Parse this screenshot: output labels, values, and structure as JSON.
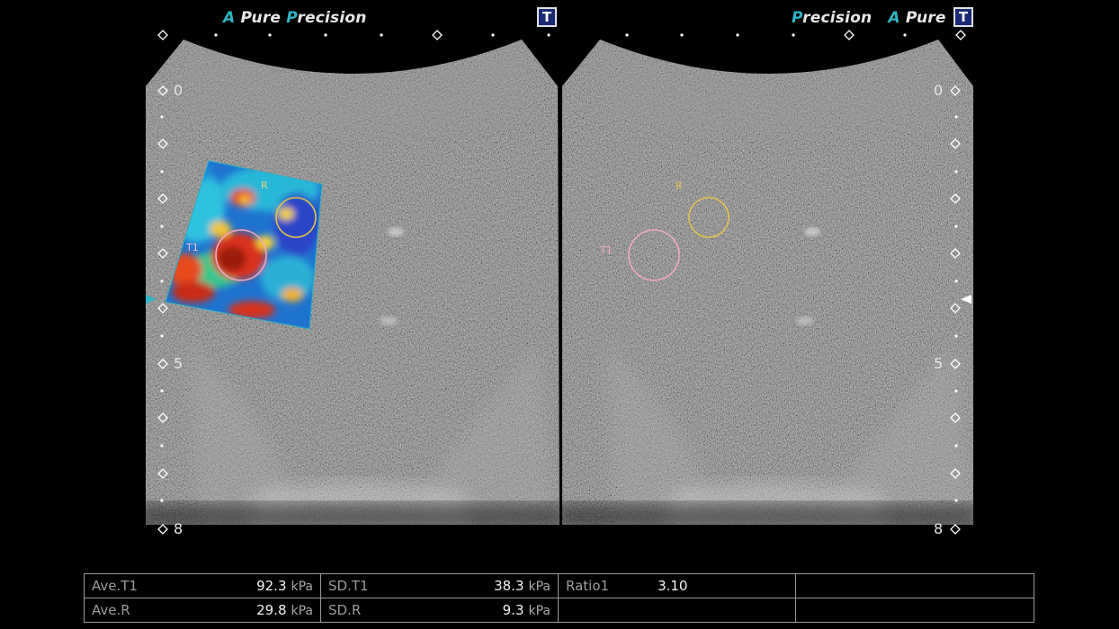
{
  "header": {
    "left": {
      "a": "A",
      "pure": "Pure",
      "p": "P",
      "recision": "recision"
    },
    "right": {
      "p": "P",
      "recision": "recision",
      "a": "A",
      "pure": "Pure"
    },
    "badge": "T"
  },
  "depth_scale": {
    "left": [
      "0",
      "5",
      "8"
    ],
    "right": [
      "0",
      "5",
      "8"
    ]
  },
  "roi": {
    "t1": "T1",
    "r": "R"
  },
  "colors": {
    "accent": "#2fb6c6",
    "t1_roi": "#f1a7c3",
    "r_roi": "#e2c24a",
    "badge_bg": "#1b2a74"
  },
  "measurements": {
    "ave_t1": {
      "label": "Ave.T1",
      "value": "92.3",
      "unit": "kPa"
    },
    "sd_t1": {
      "label": "SD.T1",
      "value": "38.3",
      "unit": "kPa"
    },
    "ratio1": {
      "label": "Ratio1",
      "value": "3.10"
    },
    "ave_r": {
      "label": "Ave.R",
      "value": "29.8",
      "unit": "kPa"
    },
    "sd_r": {
      "label": "SD.R",
      "value": "9.3",
      "unit": "kPa"
    }
  },
  "icons": [
    "depth-marker-icon",
    "focus-marker-icon",
    "roi-circle-icon",
    "t-badge-icon"
  ]
}
